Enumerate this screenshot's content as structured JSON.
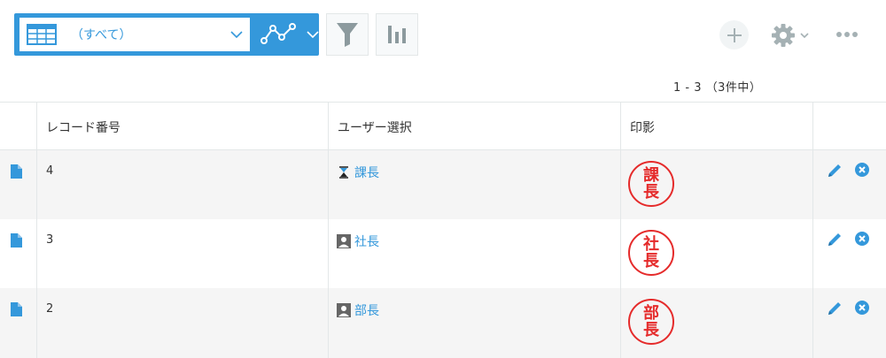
{
  "toolbar": {
    "view_select_label": "（すべて）"
  },
  "pager": {
    "text": "1 - 3 （3件中）"
  },
  "table": {
    "columns": [
      "",
      "レコード番号",
      "ユーザー選択",
      "印影",
      ""
    ],
    "rows": [
      {
        "record_number": "4",
        "user": "課長",
        "user_icon": "hourglass-icon",
        "seal_top": "課",
        "seal_bottom": "長"
      },
      {
        "record_number": "3",
        "user": "社長",
        "user_icon": "person-icon",
        "seal_top": "社",
        "seal_bottom": "長"
      },
      {
        "record_number": "2",
        "user": "部長",
        "user_icon": "person-icon",
        "seal_top": "部",
        "seal_bottom": "長"
      }
    ]
  },
  "colors": {
    "accent": "#3498db",
    "seal_red": "#e52b2b",
    "row_alt": "#f5f5f5"
  }
}
